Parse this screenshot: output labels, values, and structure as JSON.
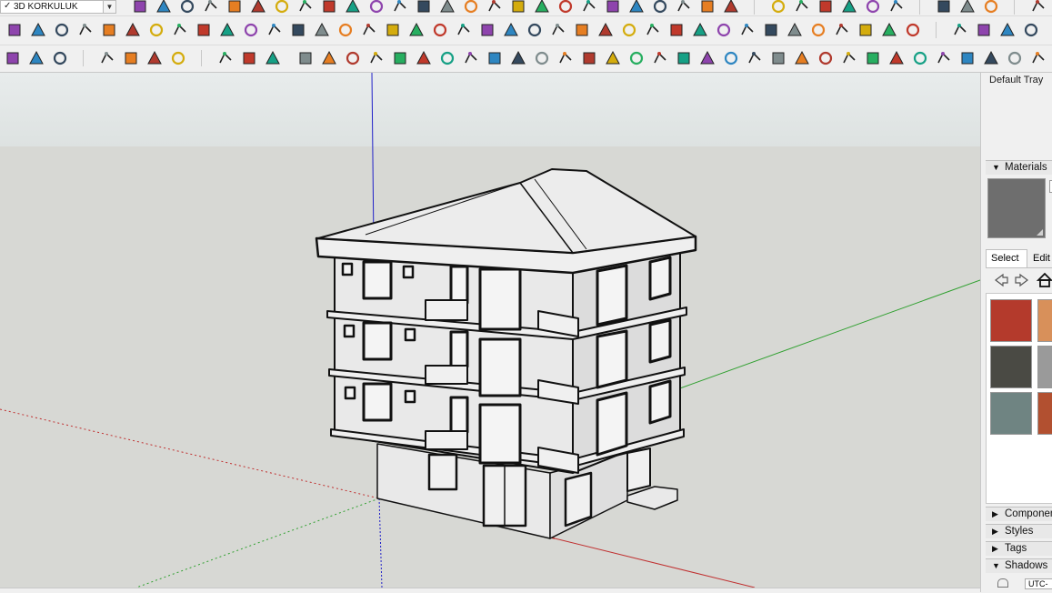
{
  "toolbar": {
    "tag_dropdown": {
      "checked": true,
      "value": "3D KORKULUK"
    }
  },
  "tray": {
    "title": "Default Tray",
    "panels": {
      "materials": {
        "label": "Materials",
        "expanded": true
      },
      "components": {
        "label": "Components",
        "expanded": false
      },
      "styles": {
        "label": "Styles",
        "expanded": false
      },
      "tags": {
        "label": "Tags",
        "expanded": false
      },
      "shadows": {
        "label": "Shadows",
        "expanded": true
      }
    },
    "materials": {
      "tabs": [
        "Select",
        "Edit"
      ],
      "active_tab": "Select",
      "preview_color": "#6e6e6e",
      "swatches": [
        {
          "name": "red-roof-tile-swatch",
          "color": "#b43a2c"
        },
        {
          "name": "orange-shingle-swatch",
          "color": "#d8905a"
        },
        {
          "name": "dark-slate-shingle-swatch",
          "color": "#4a4a44"
        },
        {
          "name": "grey-shingle-swatch",
          "color": "#9a9a9a"
        },
        {
          "name": "blue-grey-stone-swatch",
          "color": "#6f8482"
        },
        {
          "name": "terracotta-swatch",
          "color": "#b25030"
        }
      ]
    },
    "shadows": {
      "timezone_partial": "UTC-"
    }
  },
  "viewport": {
    "colors": {
      "sky_top": "#e7ebeb",
      "sky_bottom": "#dbe1e0",
      "ground": "#d7d8d4",
      "axis_blue": "#2020c8",
      "axis_red": "#c03030",
      "axis_green": "#30a030",
      "model_edges": "#111111",
      "model_faces": "#e8e8e8"
    }
  }
}
